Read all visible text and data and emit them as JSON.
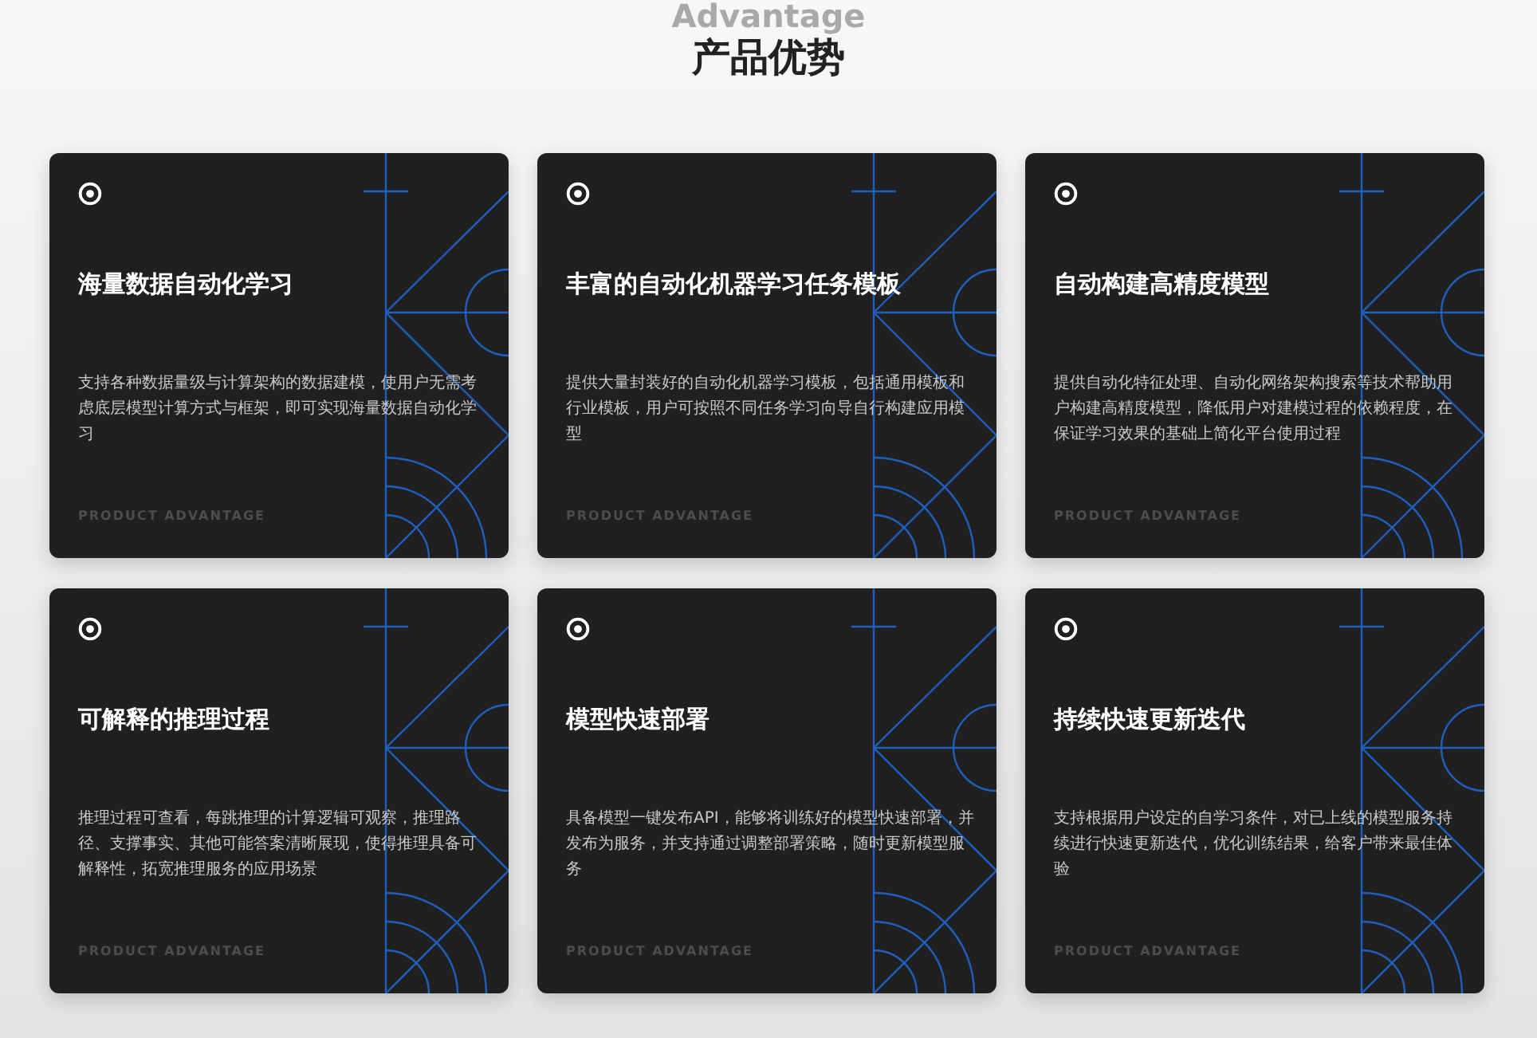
{
  "section": {
    "background_heading": "Advantage",
    "title": "产品优势"
  },
  "cards": [
    {
      "title": "海量数据自动化学习",
      "description": "支持各种数据量级与计算架构的数据建模，使用户无需考虑底层模型计算方式与框架，即可实现海量数据自动化学习",
      "footer": "PRODUCT ADVANTAGE"
    },
    {
      "title": "丰富的自动化机器学习任务模板",
      "description": "提供大量封装好的自动化机器学习模板，包括通用模板和行业模板，用户可按照不同任务学习向导自行构建应用模型",
      "footer": "PRODUCT ADVANTAGE"
    },
    {
      "title": "自动构建高精度模型",
      "description": "提供自动化特征处理、自动化网络架构搜索等技术帮助用户构建高精度模型，降低用户对建模过程的依赖程度，在保证学习效果的基础上简化平台使用过程",
      "footer": "PRODUCT ADVANTAGE"
    },
    {
      "title": "可解释的推理过程",
      "description": "推理过程可查看，每跳推理的计算逻辑可观察，推理路径、支撑事实、其他可能答案清晰展现，使得推理具备可解释性，拓宽推理服务的应用场景",
      "footer": "PRODUCT ADVANTAGE"
    },
    {
      "title": "模型快速部署",
      "description": "具备模型一键发布API，能够将训练好的模型快速部署，并发布为服务，并支持通过调整部署策略，随时更新模型服务",
      "footer": "PRODUCT ADVANTAGE"
    },
    {
      "title": "持续快速更新迭代",
      "description": "支持根据用户设定的自学习条件，对已上线的模型服务持续进行快速更新迭代，优化训练结果，给客户带来最佳体验",
      "footer": "PRODUCT ADVANTAGE"
    }
  ]
}
